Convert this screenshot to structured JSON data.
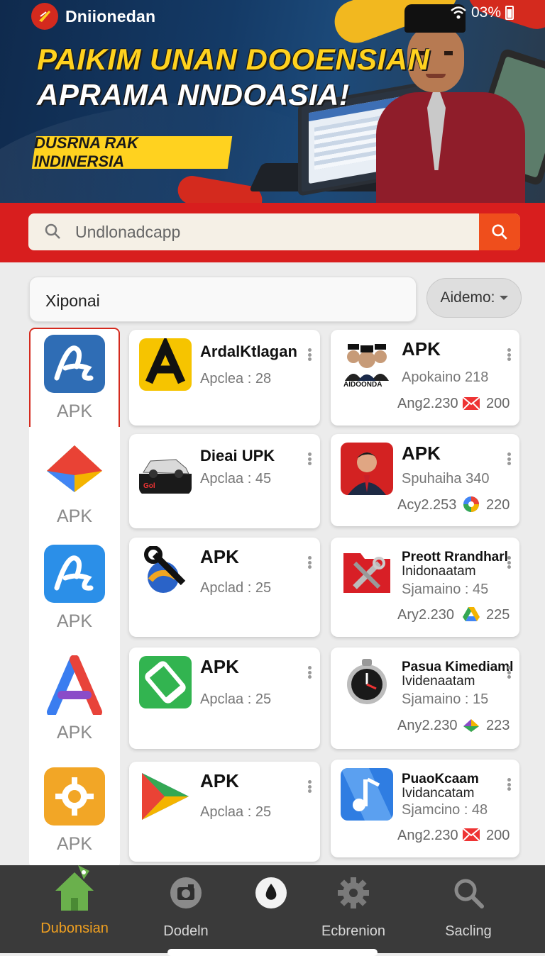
{
  "status": {
    "brand": "Dniionedan",
    "battery": "03%"
  },
  "banner": {
    "headline_1": "PAIKIM UNAN DOOENSIAN",
    "headline_2": "APRAMA NNDOASIA!",
    "tag": "DUSRNA RAK INDINERSIA"
  },
  "search": {
    "placeholder": "Undlonadcapp"
  },
  "filter": {
    "input_value": "Xiponai",
    "dropdown_label": "Aidemo:"
  },
  "sidebar": {
    "items": [
      {
        "label": "APK",
        "icon": "stylized-a-icon"
      },
      {
        "label": "APK",
        "icon": "envelope-prism-icon"
      },
      {
        "label": "APK",
        "icon": "stylized-a-blue-icon"
      },
      {
        "label": "APK",
        "icon": "triangle-a-icon"
      },
      {
        "label": "APK",
        "icon": "gear-icon"
      }
    ]
  },
  "apps_left": [
    {
      "title": "ArdalKtlagan",
      "sub": "Apclea : 28",
      "icon": "letter-a-icon"
    },
    {
      "title": "Dieai UPK",
      "sub": "Apclaa : 45",
      "icon": "car-icon",
      "icon_caption": "Gol"
    },
    {
      "title": "APK",
      "sub": "Apclad : 25",
      "icon": "wrench-wave-icon"
    },
    {
      "title": "APK",
      "sub": "Apclaa : 25",
      "icon": "phone-icon"
    },
    {
      "title": "APK",
      "sub": "Apclaa : 25",
      "icon": "play-store-icon"
    }
  ],
  "apps_right": [
    {
      "title": "APK",
      "sub": "Apokaino 218",
      "meta": "Ang2.230",
      "count": "200",
      "icon": "people-icon",
      "icon_caption": "AIDOONDA",
      "badge": "mail-badge-icon"
    },
    {
      "title": "APK",
      "sub": "Spuhaiha 340",
      "meta": "Acy2.253",
      "count": "220",
      "icon": "portrait-icon",
      "badge": "colorful-badge-icon"
    },
    {
      "title": "Preott Rrandharl",
      "title_2": "Inidonaatam",
      "sub": "Sjamaino : 45",
      "meta": "Ary2.230",
      "count": "225",
      "icon": "tools-folder-icon",
      "badge": "drive-badge-icon"
    },
    {
      "title": "Pasua Kimediaml",
      "title_2": "Ividenaatam",
      "sub": "Sjamaino : 15",
      "meta": "Any2.230",
      "count": "223",
      "icon": "clock-icon",
      "badge": "tri-badge-icon"
    },
    {
      "title": "PuaoKcaam",
      "title_2": "Ividancatam",
      "sub": "Sjamcino : 48",
      "meta": "Ang2.230",
      "count": "200",
      "icon": "music-note-icon",
      "badge": "mail-badge-icon"
    }
  ],
  "nav": [
    {
      "label": "Dubonsian",
      "icon": "home-icon",
      "active": true
    },
    {
      "label": "Dodeln",
      "icon": "camera-icon"
    },
    {
      "label": "",
      "icon": "drop-icon"
    },
    {
      "label": "Ecbrenion",
      "icon": "settings-icon"
    },
    {
      "label": "Sacling",
      "icon": "search-icon"
    }
  ],
  "colors": {
    "accent_red": "#d81e1e",
    "search_button": "#ef4e1c",
    "nav_active": "#f0a020",
    "banner_yellow": "#ffd21f"
  }
}
